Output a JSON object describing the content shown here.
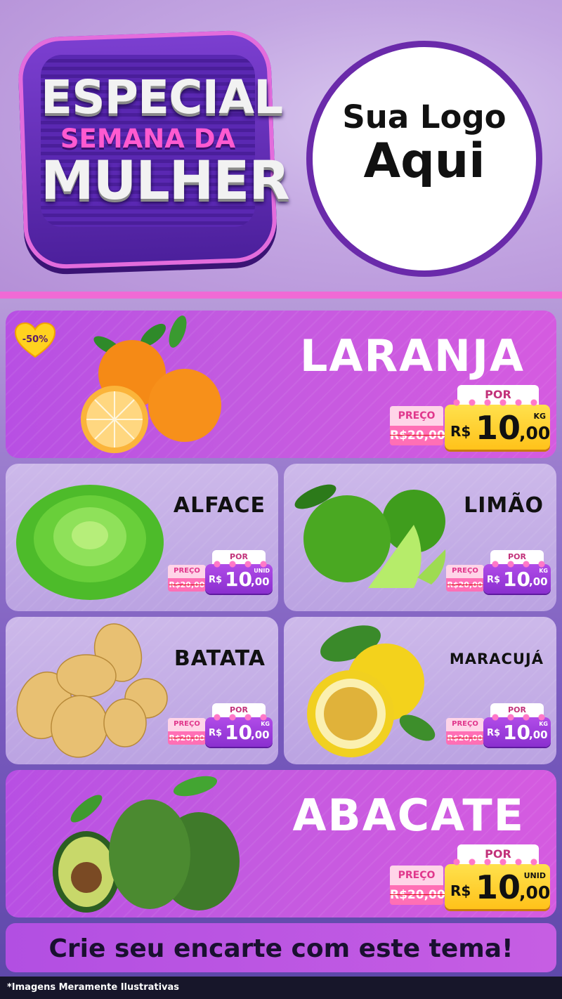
{
  "header": {
    "badge_line1": "ESPECIAL",
    "badge_line2": "SEMANA DA",
    "badge_line3": "MULHER",
    "logo_line1": "Sua Logo",
    "logo_line2": "Aqui"
  },
  "discount_badge": "-50%",
  "products": [
    {
      "name": "LARANJA",
      "preco_label": "PREÇO",
      "old_price": "R$20,00",
      "por_label": "POR",
      "currency": "R$",
      "price_int": "10",
      "price_dec": ",00",
      "unit": "KG"
    },
    {
      "name": "ALFACE",
      "preco_label": "PREÇO",
      "old_price": "R$20,00",
      "por_label": "POR",
      "currency": "R$",
      "price_int": "10",
      "price_dec": ",00",
      "unit": "UNID"
    },
    {
      "name": "LIMÃO",
      "preco_label": "PREÇO",
      "old_price": "R$20,00",
      "por_label": "POR",
      "currency": "R$",
      "price_int": "10",
      "price_dec": ",00",
      "unit": "KG"
    },
    {
      "name": "BATATA",
      "preco_label": "PREÇO",
      "old_price": "R$20,00",
      "por_label": "POR",
      "currency": "R$",
      "price_int": "10",
      "price_dec": ",00",
      "unit": "KG"
    },
    {
      "name": "MARACUJÁ",
      "preco_label": "PREÇO",
      "old_price": "R$20,00",
      "por_label": "POR",
      "currency": "R$",
      "price_int": "10",
      "price_dec": ",00",
      "unit": "KG"
    },
    {
      "name": "ABACATE",
      "preco_label": "PREÇO",
      "old_price": "R$20,00",
      "por_label": "POR",
      "currency": "R$",
      "price_int": "10",
      "price_dec": ",00",
      "unit": "UNID"
    }
  ],
  "footer": {
    "cta": "Crie seu encarte com este tema!",
    "disclaimer": "*Imagens Meramente Ilustrativas"
  },
  "colors": {
    "accent_pink": "#f06ad5",
    "card_purple": "#c25ae0",
    "price_yellow": "#ffc21a",
    "old_price_pink": "#ff6fb5"
  }
}
